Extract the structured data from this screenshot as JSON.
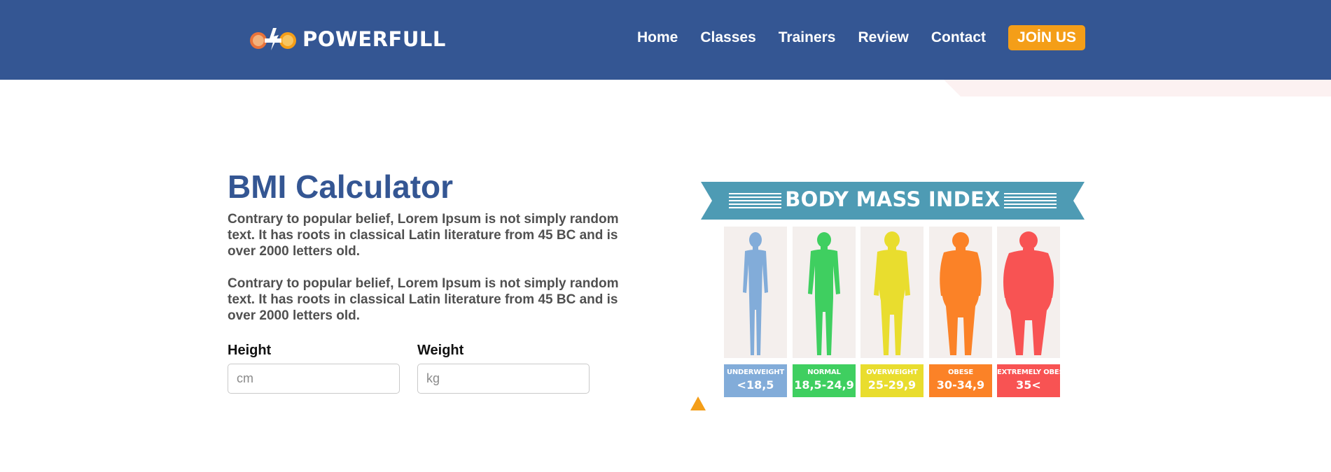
{
  "header": {
    "brand": "POWERFULL",
    "nav": [
      "Home",
      "Classes",
      "Trainers",
      "Review",
      "Contact"
    ],
    "cta": "JOİN US",
    "colors": {
      "bar": "#345693",
      "accent": "#f49e18"
    }
  },
  "main": {
    "title": "BMI Calculator",
    "paragraphs": [
      "Contrary to popular belief, Lorem Ipsum is not simply random text. It has roots in classical Latin literature from 45 BC and is over 2000 letters old.",
      "Contrary to popular belief, Lorem Ipsum is not simply random text. It has roots in classical Latin literature from 45 BC and is over 2000 letters old."
    ],
    "height_label": "Height",
    "height_placeholder": "cm",
    "weight_label": "Weight",
    "weight_placeholder": "kg"
  },
  "bmi_graphic": {
    "title": "BODY MASS INDEX",
    "categories": [
      {
        "name": "UNDERWEIGHT",
        "range": "<18,5",
        "color": "#82acd9"
      },
      {
        "name": "NORMAL",
        "range": "18,5-24,9",
        "color": "#3fcf60"
      },
      {
        "name": "OVERWEIGHT",
        "range": "25-29,9",
        "color": "#e9dd2e"
      },
      {
        "name": "OBESE",
        "range": "30-34,9",
        "color": "#fb8227"
      },
      {
        "name": "EXTREMELY OBESE",
        "range": "35<",
        "color": "#f85353"
      }
    ]
  }
}
